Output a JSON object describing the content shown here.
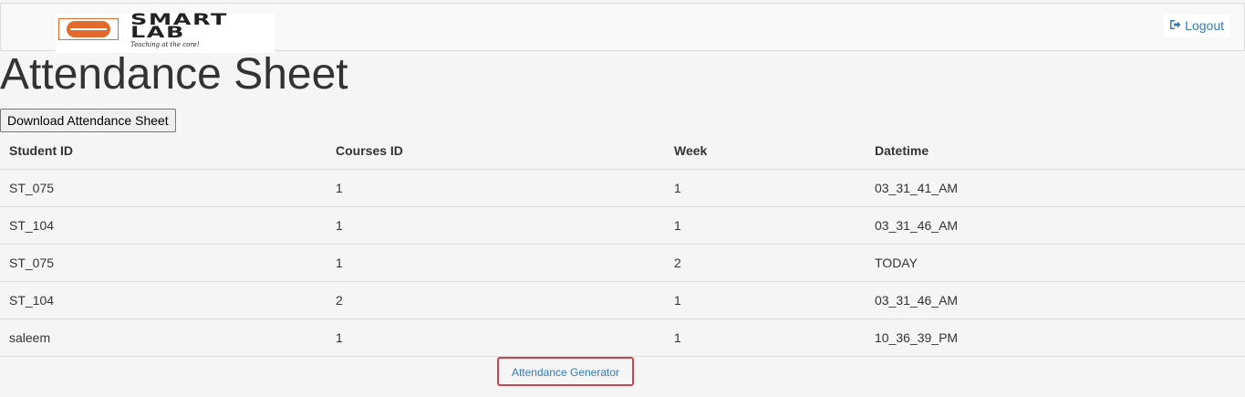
{
  "header": {
    "logo": {
      "wordmark_line1": "SMART",
      "wordmark_line2": "LAB",
      "tagline": "Teaching at the core!",
      "accent_color": "#e26a2c"
    },
    "logout_label": "Logout",
    "logout_icon": "sign-out-icon"
  },
  "page": {
    "title": "Attendance Sheet",
    "download_label": "Download Attendance Sheet"
  },
  "table": {
    "headers": [
      "Student ID",
      "Courses ID",
      "Week",
      "Datetime"
    ],
    "rows": [
      [
        "ST_075",
        "1",
        "1",
        "03_31_41_AM"
      ],
      [
        "ST_104",
        "1",
        "1",
        "03_31_46_AM"
      ],
      [
        "ST_075",
        "1",
        "2",
        "TODAY"
      ],
      [
        "ST_104",
        "2",
        "1",
        "03_31_46_AM"
      ],
      [
        "saleem",
        "1",
        "1",
        "10_36_39_PM"
      ]
    ]
  },
  "footer": {
    "generator_label": "Attendance Generator"
  },
  "colors": {
    "link": "#337ab7",
    "generator_border": "#c9464e"
  }
}
